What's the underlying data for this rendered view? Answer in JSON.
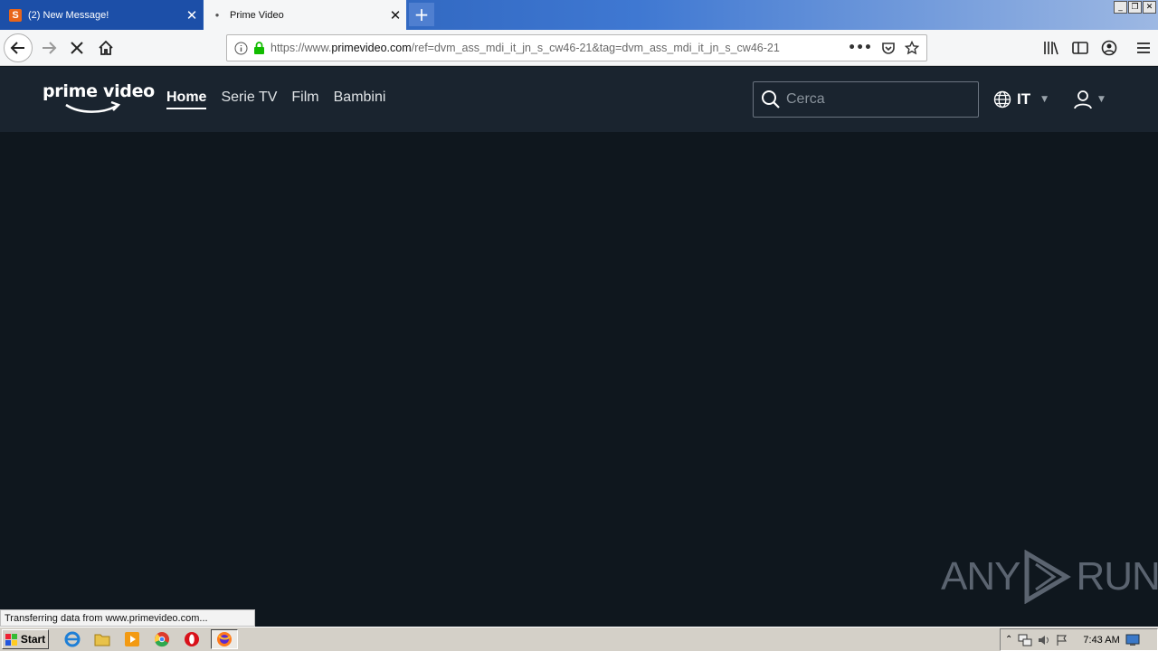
{
  "browser": {
    "tabs": [
      {
        "label": "(2) New Message!",
        "active": false,
        "favicon": "S"
      },
      {
        "label": "Prime Video",
        "active": true
      }
    ],
    "url_prefix": "https://www.",
    "url_domain": "primevideo.com",
    "url_suffix": "/ref=dvm_ass_mdi_it_jn_s_cw46-21&tag=dvm_ass_mdi_it_jn_s_cw46-21"
  },
  "site": {
    "logo": "prime video",
    "nav": [
      "Home",
      "Serie TV",
      "Film",
      "Bambini"
    ],
    "search_placeholder": "Cerca",
    "language": "IT"
  },
  "status_text": "Transferring data from www.primevideo.com...",
  "watermark": {
    "left": "ANY",
    "right": "RUN"
  },
  "taskbar": {
    "start_label": "Start",
    "clock": "7:43 AM"
  },
  "colors": {
    "header_bg": "#1a242f",
    "content_bg": "#0f171e",
    "tab_bar": "#1c4fa8"
  }
}
